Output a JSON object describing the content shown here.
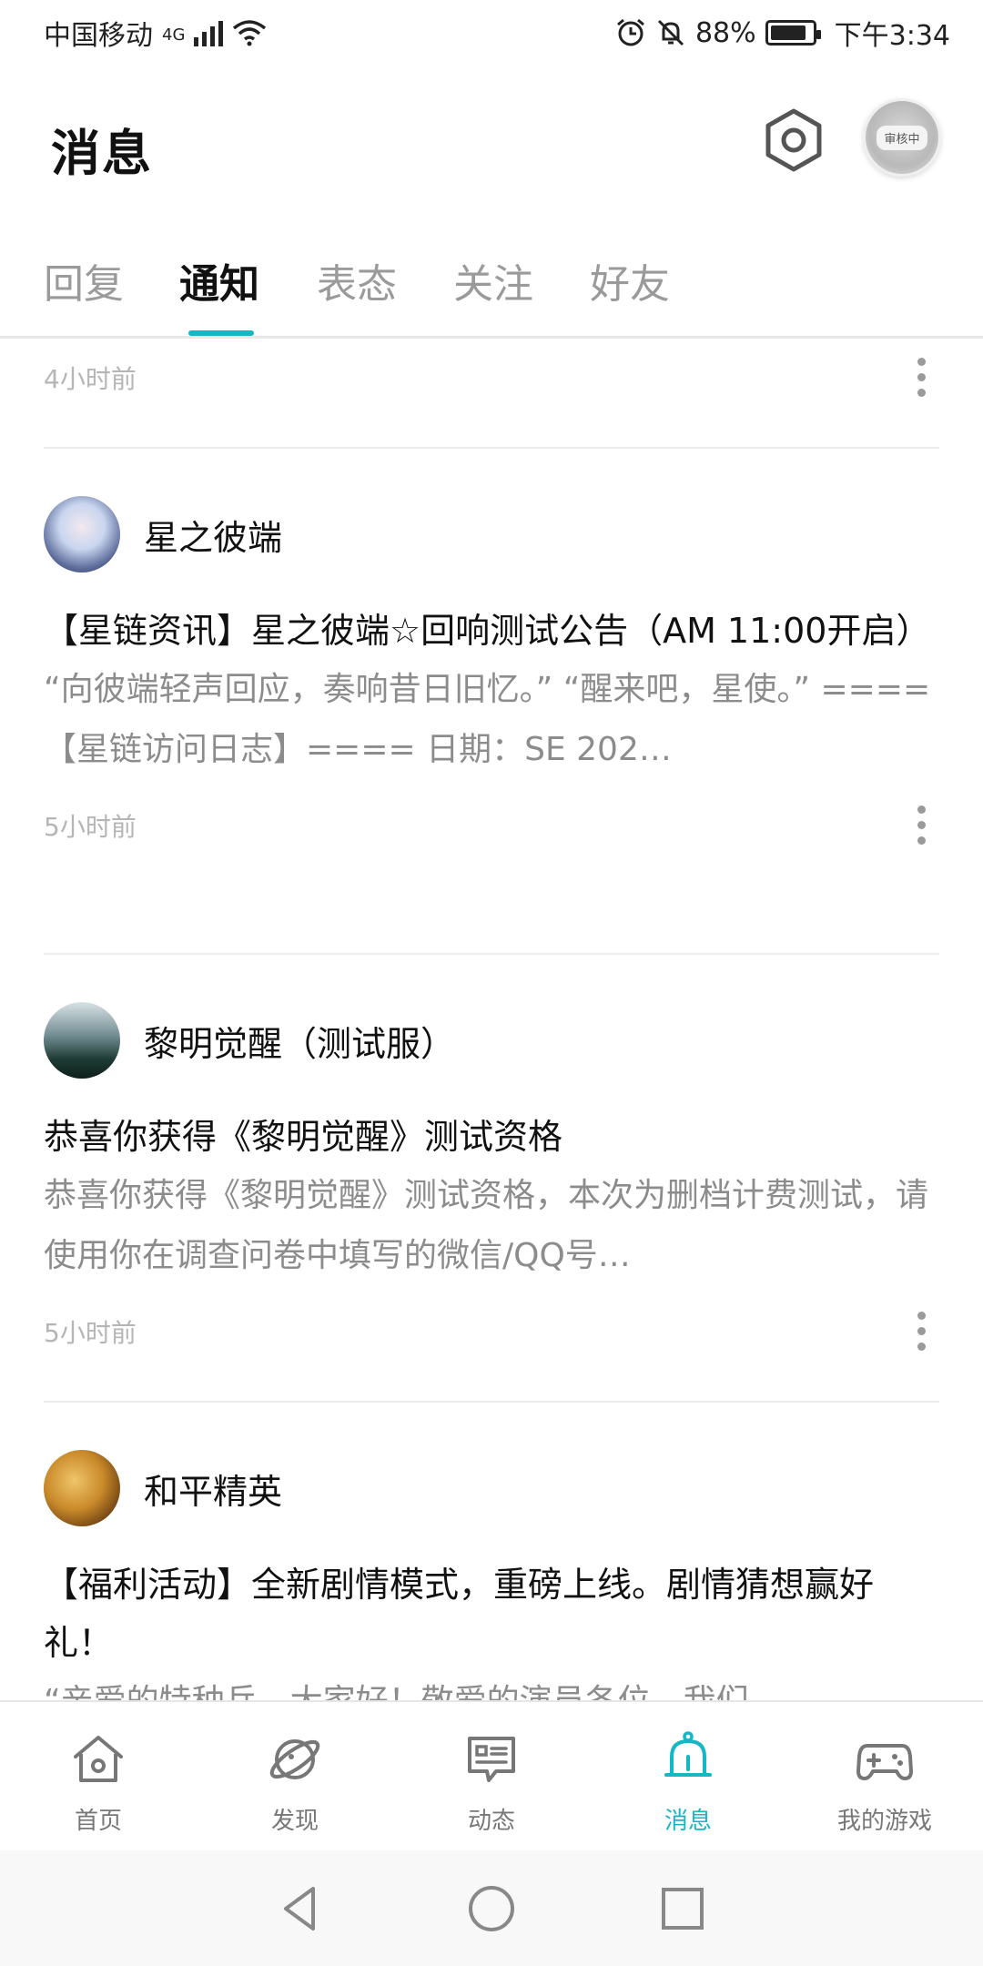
{
  "status_bar": {
    "carrier": "中国移动",
    "network": "4G",
    "battery_percent": "88%",
    "battery_level": 0.88,
    "time": "下午3:34",
    "icons": [
      "signal-icon",
      "wifi-icon",
      "alarm-icon",
      "mute-bell-icon",
      "battery-icon"
    ]
  },
  "header": {
    "title": "消息",
    "avatar_badge": "审核中",
    "icons": [
      "settings-icon"
    ]
  },
  "tabs": [
    {
      "label": "回复",
      "active": false
    },
    {
      "label": "通知",
      "active": true
    },
    {
      "label": "表态",
      "active": false
    },
    {
      "label": "关注",
      "active": false
    },
    {
      "label": "好友",
      "active": false
    }
  ],
  "accent_color": "#14b8c4",
  "feed": {
    "partial_top": {
      "time": "4小时前"
    },
    "items": [
      {
        "author": "星之彼端",
        "title": "【星链资讯】星之彼端☆回响测试公告（AM 11:00开启）",
        "excerpt": "“向彼端轻声回应，奏响昔日旧忆。” “醒来吧，星使。” ====【星链访问日志】==== 日期：SE 202…",
        "time": "5小时前"
      },
      {
        "author": "黎明觉醒（测试服）",
        "title": "恭喜你获得《黎明觉醒》测试资格",
        "excerpt": "恭喜你获得《黎明觉醒》测试资格，本次为删档计费测试，请使用你在调查问卷中填写的微信/QQ号…",
        "time": "5小时前"
      },
      {
        "author": "和平精英",
        "title": "【福利活动】全新剧情模式，重磅上线。剧情猜想赢好礼！",
        "excerpt": "“亲爱的特种兵，大家好！敬爱的演员各位，我们"
      }
    ]
  },
  "bottom_nav": [
    {
      "label": "首页",
      "icon": "home-icon",
      "active": false
    },
    {
      "label": "发现",
      "icon": "planet-icon",
      "active": false
    },
    {
      "label": "动态",
      "icon": "chat-card-icon",
      "active": false
    },
    {
      "label": "消息",
      "icon": "bell-icon",
      "active": true
    },
    {
      "label": "我的游戏",
      "icon": "gamepad-icon",
      "active": false
    }
  ],
  "system_nav": [
    "back-icon",
    "home-circle-icon",
    "recent-apps-icon"
  ]
}
